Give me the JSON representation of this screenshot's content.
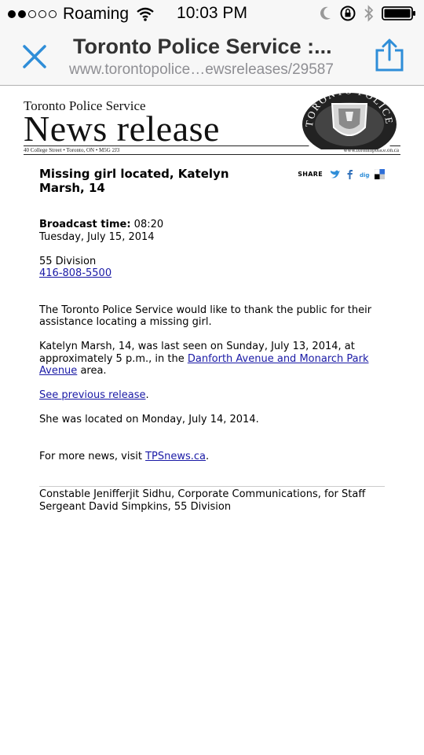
{
  "status_bar": {
    "carrier": "Roaming",
    "time": "10:03 PM",
    "signal_bars_filled": 2,
    "signal_bars_total": 5,
    "icons": [
      "wifi-icon",
      "moon-icon",
      "rotation-lock-icon",
      "bluetooth-icon",
      "battery-icon"
    ]
  },
  "browser": {
    "page_title": "Toronto Police Service :...",
    "url": "www.torontopolice…ewsreleases/29587",
    "close_icon": "close-icon",
    "share_icon": "share-icon"
  },
  "banner": {
    "organization": "Toronto Police Service",
    "title": "News release",
    "address": "40 College Street  •  Toronto, ON  •  M5G 2J3",
    "website": "www.torontopolice.on.ca",
    "badge_text": "TORONTO POLICE"
  },
  "article": {
    "headline": "Missing girl located, Katelyn Marsh, 14",
    "share_label": "SHARE",
    "share_icons": [
      "twitter-icon",
      "facebook-icon",
      "digg-icon",
      "delicious-icon"
    ],
    "broadcast_label": "Broadcast time:",
    "broadcast_time": "08:20",
    "date": "Tuesday, July 15, 2014",
    "division": "55 Division",
    "phone": "416-808-5500",
    "para1": "The Toronto Police Service would like to thank the public for their assistance locating a missing girl.",
    "para2_before": "Katelyn Marsh, 14, was last seen on Sunday, July 13, 2014, at approximately 5 p.m., in the ",
    "para2_link": "Danforth Avenue and Monarch Park Avenue",
    "para2_after": " area.",
    "previous_link": "See previous release",
    "previous_after": ".",
    "located": "She was located on Monday, July 14, 2014.",
    "more_before": "For more news, visit ",
    "more_link": "TPSnews.ca",
    "more_after": ".",
    "footer": "Constable Jenifferjit Sidhu, Corporate Communications, for Staff Sergeant David Simpkins, 55 Division"
  },
  "colors": {
    "ios_blue": "#2f8ed8",
    "link": "#1a1aa6",
    "bar_bg": "#f7f7f7"
  }
}
